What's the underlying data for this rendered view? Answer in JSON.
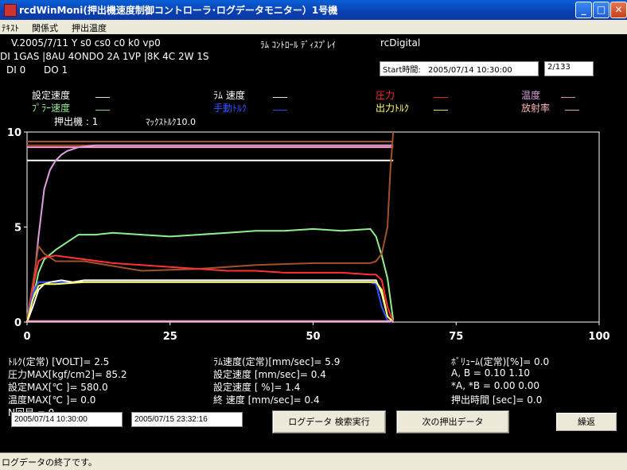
{
  "window": {
    "title": "rcdWinMoni(押出機速度制御コントローラ･ログデータモニター）1号機",
    "min": "_",
    "max": "□",
    "close": "✕"
  },
  "menu": [
    "ﾃｷｽﾄ",
    "関係式",
    "押出温度"
  ],
  "header": {
    "version": "V.2005/7/11 Y s0 cs0 c0 k0 vp0",
    "ram_display": "ﾗﾑ ｺﾝﾄﾛｰﾙ ﾃﾞｨｽﾌﾟﾚｲ",
    "rc_digital": "rcDigital",
    "config": "DI 1GAS |8AU 4ONDO 2A 1VP |8K 4C 2W 1S",
    "di": "DI 0",
    "do": "DO 1",
    "start_label": "Start時間:",
    "start_value": "2005/07/14 10:30:00",
    "page": "2/133"
  },
  "legend": {
    "set_speed": "設定速度",
    "set_speed_val": "___",
    "ram_speed": "ﾗﾑ 速度",
    "ram_speed_val": "___",
    "pressure": "圧力",
    "pressure_val": "___",
    "temp": "温度",
    "temp_val": "___",
    "puller_speed": "ﾌﾟﾗｰ速度",
    "puller_speed_val": "___",
    "manual_torque": "手動ﾄﾙｸ",
    "manual_torque_val": "___",
    "output_torque": "出力ﾄﾙｸ",
    "output_torque_val": "___",
    "radiation": "放射率",
    "radiation_val": "___",
    "extruder": "押出機 : 1",
    "max_torque": "ﾏｯｸｽﾄﾙｸ10.0"
  },
  "stats": {
    "col1": [
      "ﾄﾙｸ(定常)  [VOLT]= 2.5",
      "圧力MAX[kgf/cm2]= 85.2",
      "設定MAX[℃   ]= 580.0",
      "温度MAX[℃   ]= 0.0",
      "N回目 = 0"
    ],
    "col2": [
      "ﾗﾑ速度(定常)[mm/sec]= 5.9",
      "設定速度       [mm/sec]= 0.4",
      "設定速度            [ %]= 1.4",
      "終  速度          [mm/sec]= 0.4"
    ],
    "col3": [
      "ﾎﾞﾘｭｰﾑ(定常)[%]= 0.0",
      "  A,  B              = 0.10 1.10",
      "  *A,  *B            = 0.00 0.00",
      "押出時間   [sec]= 0.0"
    ]
  },
  "controls": {
    "date_from": "2005/07/14 10:30:00",
    "date_to": "2005/07/15 23:32:16",
    "search_button": "ログデータ  検索実行",
    "next_button": "次の押出データ",
    "repeat_button": "繰返"
  },
  "status": "ログデータの終了です。",
  "chart_data": {
    "type": "line",
    "xlim": [
      0,
      100
    ],
    "ylim": [
      0,
      10
    ],
    "xticks": [
      0,
      25,
      50,
      75,
      100
    ],
    "yticks": [
      0,
      5,
      10
    ],
    "grid": false,
    "series": [
      {
        "color": "#ffffff",
        "x": [
          0,
          64
        ],
        "y": [
          8.5,
          8.5
        ]
      },
      {
        "color": "#a0522d",
        "x": [
          0,
          64
        ],
        "y": [
          9.3,
          9.3
        ]
      },
      {
        "color": "#a0522d",
        "x": [
          0,
          64
        ],
        "y": [
          9.5,
          9.5
        ]
      },
      {
        "color": "#ff99cc",
        "x": [
          0,
          64
        ],
        "y": [
          9.2,
          9.2
        ]
      },
      {
        "color": "#dda0dd",
        "x": [
          0,
          1,
          2,
          3,
          4,
          5,
          6,
          7,
          9,
          12,
          20,
          30,
          40,
          50,
          62,
          64
        ],
        "y": [
          0,
          1.5,
          4.5,
          7,
          8,
          8.5,
          8.8,
          9,
          9.2,
          9.3,
          9.3,
          9.3,
          9.3,
          9.3,
          9.3,
          9.3
        ]
      },
      {
        "color": "#90ee90",
        "x": [
          0,
          1,
          2,
          3,
          5,
          7,
          9,
          12,
          15,
          20,
          25,
          30,
          35,
          40,
          45,
          50,
          55,
          60,
          61,
          62,
          63,
          64
        ],
        "y": [
          0.3,
          1.2,
          2.6,
          3.3,
          3.8,
          4.2,
          4.6,
          4.6,
          4.7,
          4.6,
          4.5,
          4.6,
          4.7,
          4.8,
          4.8,
          4.9,
          4.8,
          4.9,
          4.5,
          3.5,
          2.3,
          0.1
        ]
      },
      {
        "color": "#a0522d",
        "x": [
          0,
          1,
          2,
          3,
          5,
          10,
          20,
          30,
          40,
          50,
          55,
          60,
          61,
          62,
          63,
          63.5,
          64
        ],
        "y": [
          0.2,
          2,
          4,
          3.6,
          3.2,
          3.2,
          2.7,
          2.8,
          3.0,
          3.1,
          3.1,
          3.1,
          3.2,
          3.6,
          5,
          8,
          10
        ]
      },
      {
        "color": "#ff3333",
        "x": [
          0,
          1,
          2,
          3,
          5,
          10,
          15,
          20,
          25,
          30,
          35,
          40,
          45,
          50,
          55,
          60,
          61,
          62,
          63,
          64
        ],
        "y": [
          0,
          1.8,
          3.2,
          3.4,
          3.5,
          3.3,
          3.1,
          3.0,
          2.9,
          2.8,
          2.7,
          2.7,
          2.6,
          2.6,
          2.6,
          2.5,
          2.5,
          2.2,
          0.8,
          0
        ]
      },
      {
        "color": "#3355ff",
        "x": [
          0,
          1,
          2,
          3,
          5,
          10,
          20,
          30,
          40,
          50,
          60,
          61,
          62,
          63,
          64
        ],
        "y": [
          0,
          1.5,
          2.1,
          2.1,
          2.1,
          2.1,
          2.1,
          2.1,
          2.1,
          2.1,
          2.1,
          2.0,
          0.8,
          0.1,
          0
        ]
      },
      {
        "color": "#ffffff",
        "x": [
          0,
          1,
          2,
          3,
          4,
          6,
          8,
          10,
          15,
          20,
          30,
          40,
          50,
          60,
          61,
          62,
          63,
          64
        ],
        "y": [
          0,
          0.8,
          1.7,
          2.0,
          2.1,
          2.2,
          2.1,
          2.2,
          2.2,
          2.2,
          2.2,
          2.2,
          2.2,
          2.2,
          2.2,
          1.5,
          0.3,
          0
        ]
      },
      {
        "color": "#ffff66",
        "x": [
          0,
          1,
          2,
          3,
          5,
          10,
          20,
          30,
          40,
          50,
          60,
          61,
          62,
          63,
          64
        ],
        "y": [
          0,
          1.2,
          1.9,
          2.0,
          2.0,
          2.1,
          2.1,
          2.1,
          2.1,
          2.1,
          2.1,
          2.1,
          1.7,
          0.3,
          0
        ]
      },
      {
        "color": "#ff99cc",
        "x": [
          0,
          64
        ],
        "y": [
          0.05,
          0.05
        ]
      }
    ]
  }
}
